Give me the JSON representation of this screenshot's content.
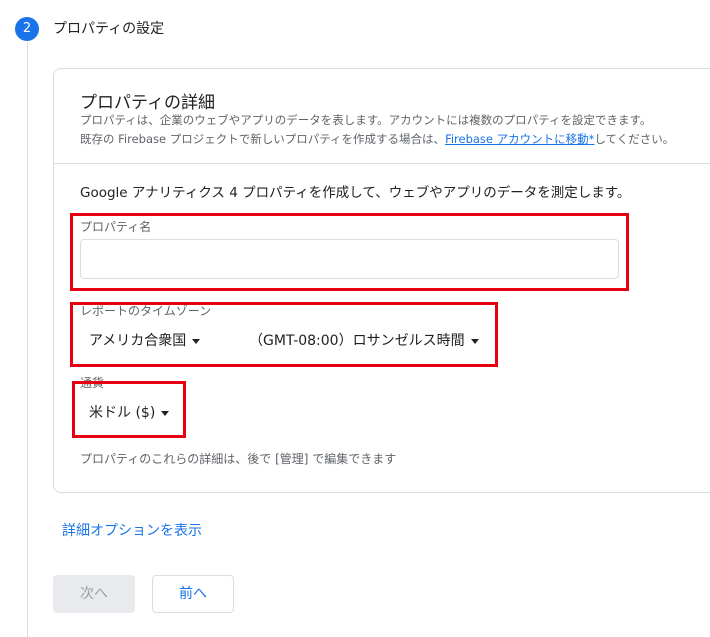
{
  "step": {
    "number": "2",
    "title": "プロパティの設定"
  },
  "details": {
    "title": "プロパティの詳細",
    "desc_line1": "プロパティは、企業のウェブやアプリのデータを表します。アカウントには複数のプロパティを設定できます。",
    "desc_line2_prefix": "既存の Firebase プロジェクトで新しいプロパティを作成する場合は、",
    "desc_link": "Firebase アカウントに移動",
    "desc_link_mark": "*",
    "desc_line2_suffix": "してください。"
  },
  "form": {
    "intro": "Google アナリティクス 4 プロパティを作成して、ウェブやアプリのデータを測定します。",
    "property_name": {
      "label": "プロパティ名",
      "value": "",
      "placeholder": ""
    },
    "timezone": {
      "label": "レポートのタイムゾーン",
      "country": "アメリカ合衆国",
      "zone": "（GMT-08:00）ロサンゼルス時間"
    },
    "currency": {
      "label": "通貨",
      "value": "米ドル ($)"
    },
    "note": "プロパティのこれらの詳細は、後で [管理] で編集できます"
  },
  "advanced_link": "詳細オプションを表示",
  "buttons": {
    "next": "次へ",
    "prev": "前へ"
  },
  "colors": {
    "accent": "#1a73e8",
    "highlight": "#e60012",
    "border": "#dadce0"
  },
  "icons": {
    "dropdown": "caret-down-icon"
  }
}
